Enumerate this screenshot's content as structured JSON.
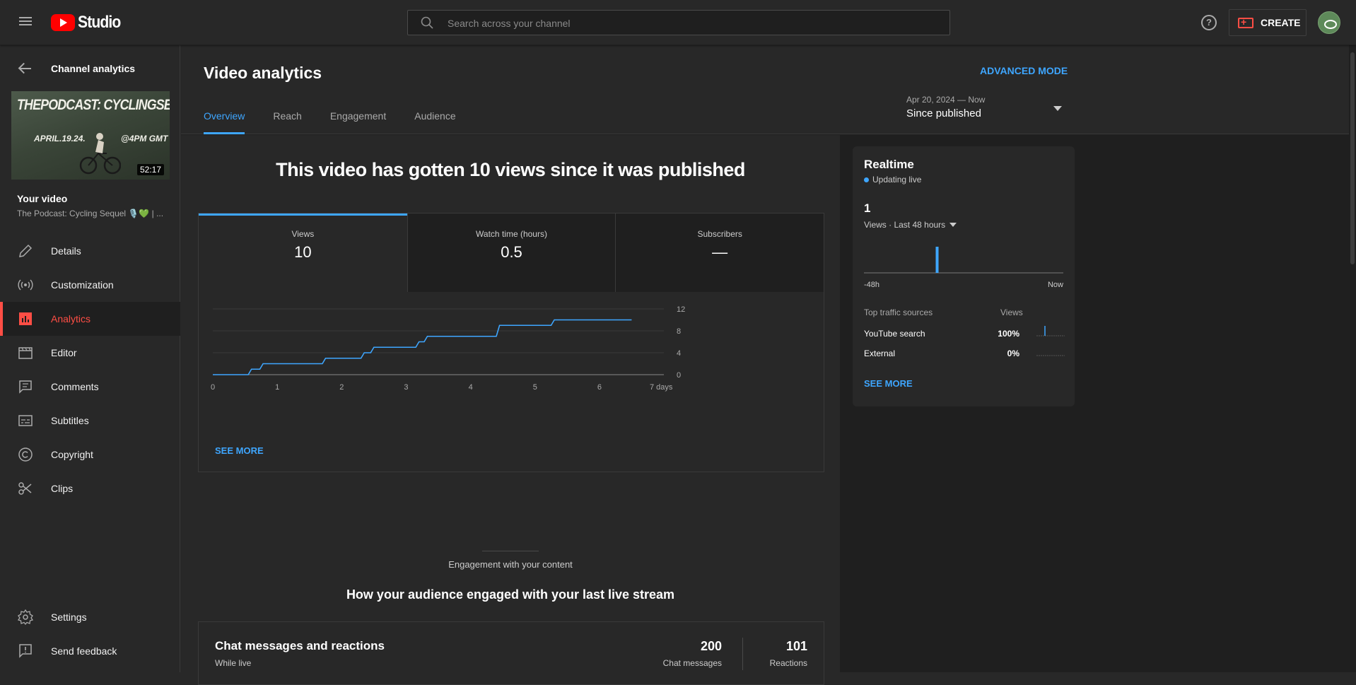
{
  "app": {
    "logo_text": "Studio",
    "search_placeholder": "Search across your channel",
    "create_label": "CREATE"
  },
  "sidebar": {
    "back_label": "Channel analytics",
    "thumbnail": {
      "title_text": "THEPODCAST: CYCLINGSEQUEL",
      "date_text": "APRIL.19.24.",
      "time_text": "@4PM GMT",
      "duration": "52:17"
    },
    "your_video_label": "Your video",
    "video_title": "The Podcast: Cycling Sequel 🎙️💚 | ...",
    "items": [
      {
        "label": "Details",
        "icon": "pencil-icon"
      },
      {
        "label": "Customization",
        "icon": "broadcast-icon"
      },
      {
        "label": "Analytics",
        "icon": "bar-chart-icon",
        "active": true
      },
      {
        "label": "Editor",
        "icon": "clapper-icon"
      },
      {
        "label": "Comments",
        "icon": "comment-icon"
      },
      {
        "label": "Subtitles",
        "icon": "subtitles-icon"
      },
      {
        "label": "Copyright",
        "icon": "copyright-icon"
      },
      {
        "label": "Clips",
        "icon": "scissors-icon"
      }
    ],
    "bottom_items": [
      {
        "label": "Settings",
        "icon": "gear-icon"
      },
      {
        "label": "Send feedback",
        "icon": "feedback-icon"
      }
    ]
  },
  "header": {
    "title": "Video analytics",
    "advanced_mode": "ADVANCED MODE",
    "tabs": [
      "Overview",
      "Reach",
      "Engagement",
      "Audience"
    ],
    "active_tab": "Overview",
    "date_range": "Apr 20, 2024 — Now",
    "date_label": "Since published"
  },
  "overview": {
    "headline": "This video has gotten 10 views since it was published",
    "metrics": [
      {
        "label": "Views",
        "value": "10"
      },
      {
        "label": "Watch time (hours)",
        "value": "0.5"
      },
      {
        "label": "Subscribers",
        "value": "—"
      }
    ],
    "see_more": "SEE MORE"
  },
  "chart_data": {
    "type": "line",
    "x": [
      0,
      0.55,
      0.6,
      0.73,
      0.78,
      1.7,
      1.75,
      2.3,
      2.35,
      2.45,
      2.5,
      3.15,
      3.2,
      3.28,
      3.33,
      4.4,
      4.45,
      5.25,
      5.3,
      6.5
    ],
    "y": [
      0,
      0,
      1,
      1,
      2,
      2,
      3,
      3,
      4,
      4,
      5,
      5,
      6,
      6,
      7,
      7,
      9,
      9,
      10,
      10
    ],
    "x_ticks": [
      "0",
      "1",
      "2",
      "3",
      "4",
      "5",
      "6",
      "7 days"
    ],
    "y_ticks": [
      "0",
      "4",
      "8",
      "12"
    ],
    "xlim": [
      0,
      7
    ],
    "ylim": [
      0,
      12
    ],
    "grid": true,
    "color": "#3ea6ff"
  },
  "engagement": {
    "subtitle": "Engagement with your content",
    "title": "How your audience engaged with your last live stream",
    "chat_card": {
      "title": "Chat messages and reactions",
      "subtitle": "While live",
      "chat_messages_value": "200",
      "chat_messages_label": "Chat messages",
      "reactions_value": "101",
      "reactions_label": "Reactions",
      "y_tick": "38"
    }
  },
  "realtime": {
    "title": "Realtime",
    "status": "Updating live",
    "views": "1",
    "views_selector": "Views · Last 48 hours",
    "start_label": "-48h",
    "end_label": "Now",
    "bar_position_fraction": 0.36,
    "traffic_header_left": "Top traffic sources",
    "traffic_header_right": "Views",
    "sources": [
      {
        "name": "YouTube search",
        "pct": "100%"
      },
      {
        "name": "External",
        "pct": "0%"
      }
    ],
    "see_more": "SEE MORE"
  }
}
